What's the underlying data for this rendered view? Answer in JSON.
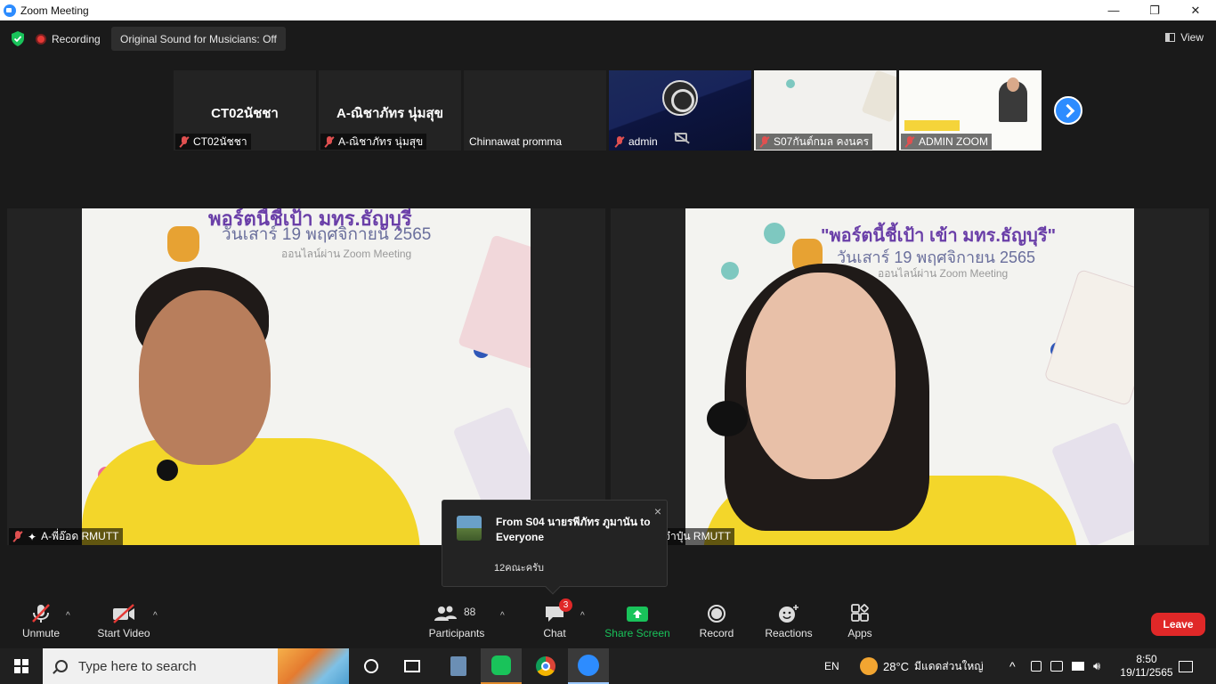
{
  "window": {
    "title": "Zoom Meeting",
    "minimize": "—",
    "maximize": "❐",
    "close": "✕"
  },
  "topbar": {
    "recording": "Recording",
    "original_sound": "Original Sound for Musicians: Off",
    "view": "View"
  },
  "thumbnails": [
    {
      "big_name": "CT02นัชชา",
      "label": "CT02นัชชา",
      "muted": true
    },
    {
      "big_name": "A-ณิชาภัทร นุ่มสุข",
      "label": "A-ณิชาภัทร นุ่มสุข",
      "muted": true
    },
    {
      "big_name": "",
      "label": "Chinnawat promma",
      "muted": false
    },
    {
      "big_name": "",
      "label": "admin",
      "muted": true
    },
    {
      "big_name": "",
      "label": "S07กันต์กมล คงนคร",
      "muted": true
    },
    {
      "big_name": "",
      "label": "ADMIN ZOOM",
      "muted": true
    }
  ],
  "slide": {
    "title_left": "พอร์ตนี้ชี้เป้า มทร.ธัญบุรี",
    "title_right": "\"พอร์ตนี้ชี้เป้า เข้า มทร.ธัญบุรี\"",
    "date": "วันเสาร์ 19 พฤศจิกายน 2565",
    "sub": "ออนไลน์ผ่าน Zoom Meeting"
  },
  "tiles": {
    "left_name": "A-พี่อ๊อด RMUTT",
    "right_name": "จ๋าปุ๋น RMUTT"
  },
  "chat_toast": {
    "from": "From S04 นายรพีภัทร ภูมานัน to Everyone",
    "message": "12คณะครับ",
    "close": "×"
  },
  "toolbar": {
    "unmute": "Unmute",
    "start_video": "Start Video",
    "participants": "Participants",
    "participants_count": "88",
    "chat": "Chat",
    "chat_badge": "3",
    "share_screen": "Share Screen",
    "record": "Record",
    "reactions": "Reactions",
    "apps": "Apps",
    "leave": "Leave"
  },
  "taskbar": {
    "search_placeholder": "Type here to search",
    "lang": "EN",
    "temperature": "28°C",
    "weather": "มีแดดส่วนใหญ่",
    "time": "8:50",
    "date": "19/11/2565"
  },
  "colors": {
    "accent": "#2d8cff",
    "leave": "#e02828",
    "share": "#19c35a",
    "shirt": "#f3d62a"
  }
}
